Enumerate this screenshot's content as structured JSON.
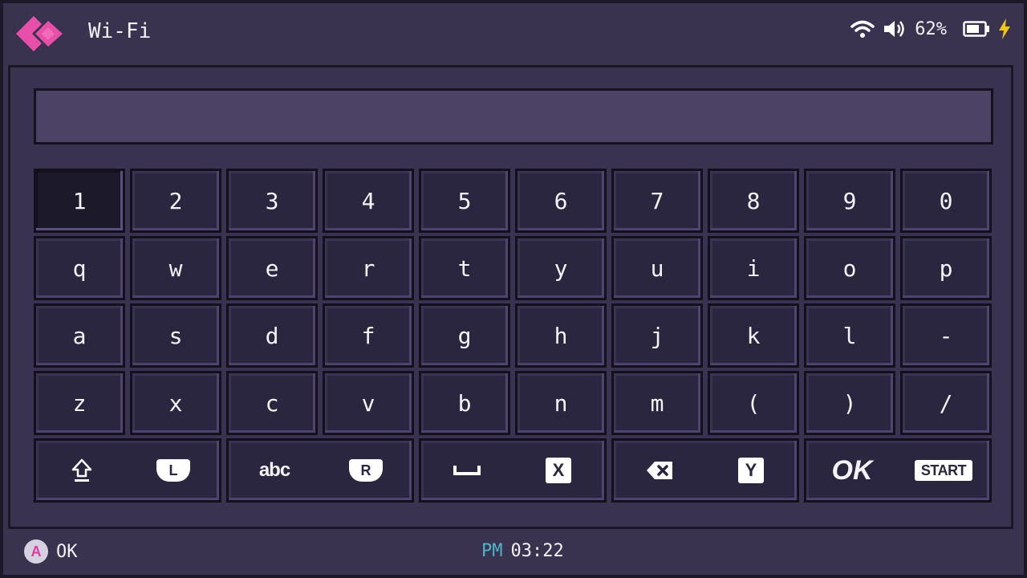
{
  "header": {
    "title": "Wi-Fi",
    "battery_percent": "62%",
    "icons": [
      "back-icon",
      "wifi-icon",
      "volume-icon",
      "battery-icon",
      "charging-bolt-icon"
    ]
  },
  "text_field": {
    "value": ""
  },
  "keyboard": {
    "rows": [
      [
        "1",
        "2",
        "3",
        "4",
        "5",
        "6",
        "7",
        "8",
        "9",
        "0"
      ],
      [
        "q",
        "w",
        "e",
        "r",
        "t",
        "y",
        "u",
        "i",
        "o",
        "p"
      ],
      [
        "a",
        "s",
        "d",
        "f",
        "g",
        "h",
        "j",
        "k",
        "l",
        "-"
      ],
      [
        "z",
        "x",
        "c",
        "v",
        "b",
        "n",
        "m",
        "(",
        ")",
        "/"
      ]
    ],
    "selected": "1",
    "function_keys": {
      "shift": {
        "icon": "shift-arrow-icon",
        "button": "L"
      },
      "layout": {
        "label": "abc",
        "button": "R"
      },
      "space": {
        "icon": "space-bar-icon",
        "button": "X"
      },
      "backspace": {
        "icon": "backspace-icon",
        "button": "Y"
      },
      "ok": {
        "label": "OK",
        "button": "START"
      }
    }
  },
  "footer": {
    "hint_button": "A",
    "hint_label": "OK",
    "ampm": "PM",
    "time": "03:22"
  },
  "colors": {
    "accent": "#e84fa8",
    "background": "#3a3350",
    "key": "#2b2640",
    "ampm": "#4fb3c8",
    "charging": "#f0c419"
  }
}
